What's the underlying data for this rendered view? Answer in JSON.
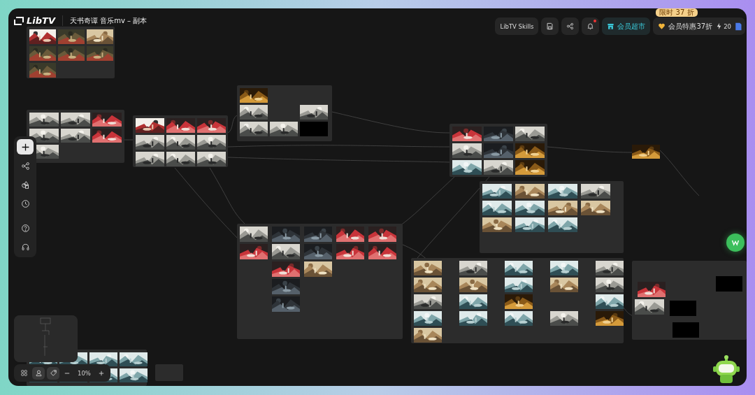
{
  "header": {
    "logo": "LibTV",
    "project_title": "天书奇谭 音乐mv – 副本"
  },
  "actions": {
    "skills_label": "LibTV Skills",
    "notification_unread": true,
    "market_label": "会员超市",
    "promo_badge": "限时 37 折",
    "member_label": "会员特惠37折",
    "credits": "20"
  },
  "side_tools": [
    {
      "kind": "add",
      "selected": true
    },
    {
      "kind": "workflow",
      "selected": false
    },
    {
      "kind": "assets",
      "selected": false
    },
    {
      "kind": "history",
      "selected": false
    },
    {
      "kind": "help",
      "selected": false
    },
    {
      "kind": "support",
      "selected": false
    }
  ],
  "view_controls": {
    "tools": [
      {
        "kind": "layout",
        "selected": false
      },
      {
        "kind": "person",
        "selected": true
      },
      {
        "kind": "tag",
        "selected": true
      }
    ],
    "zoom": "10%"
  }
}
